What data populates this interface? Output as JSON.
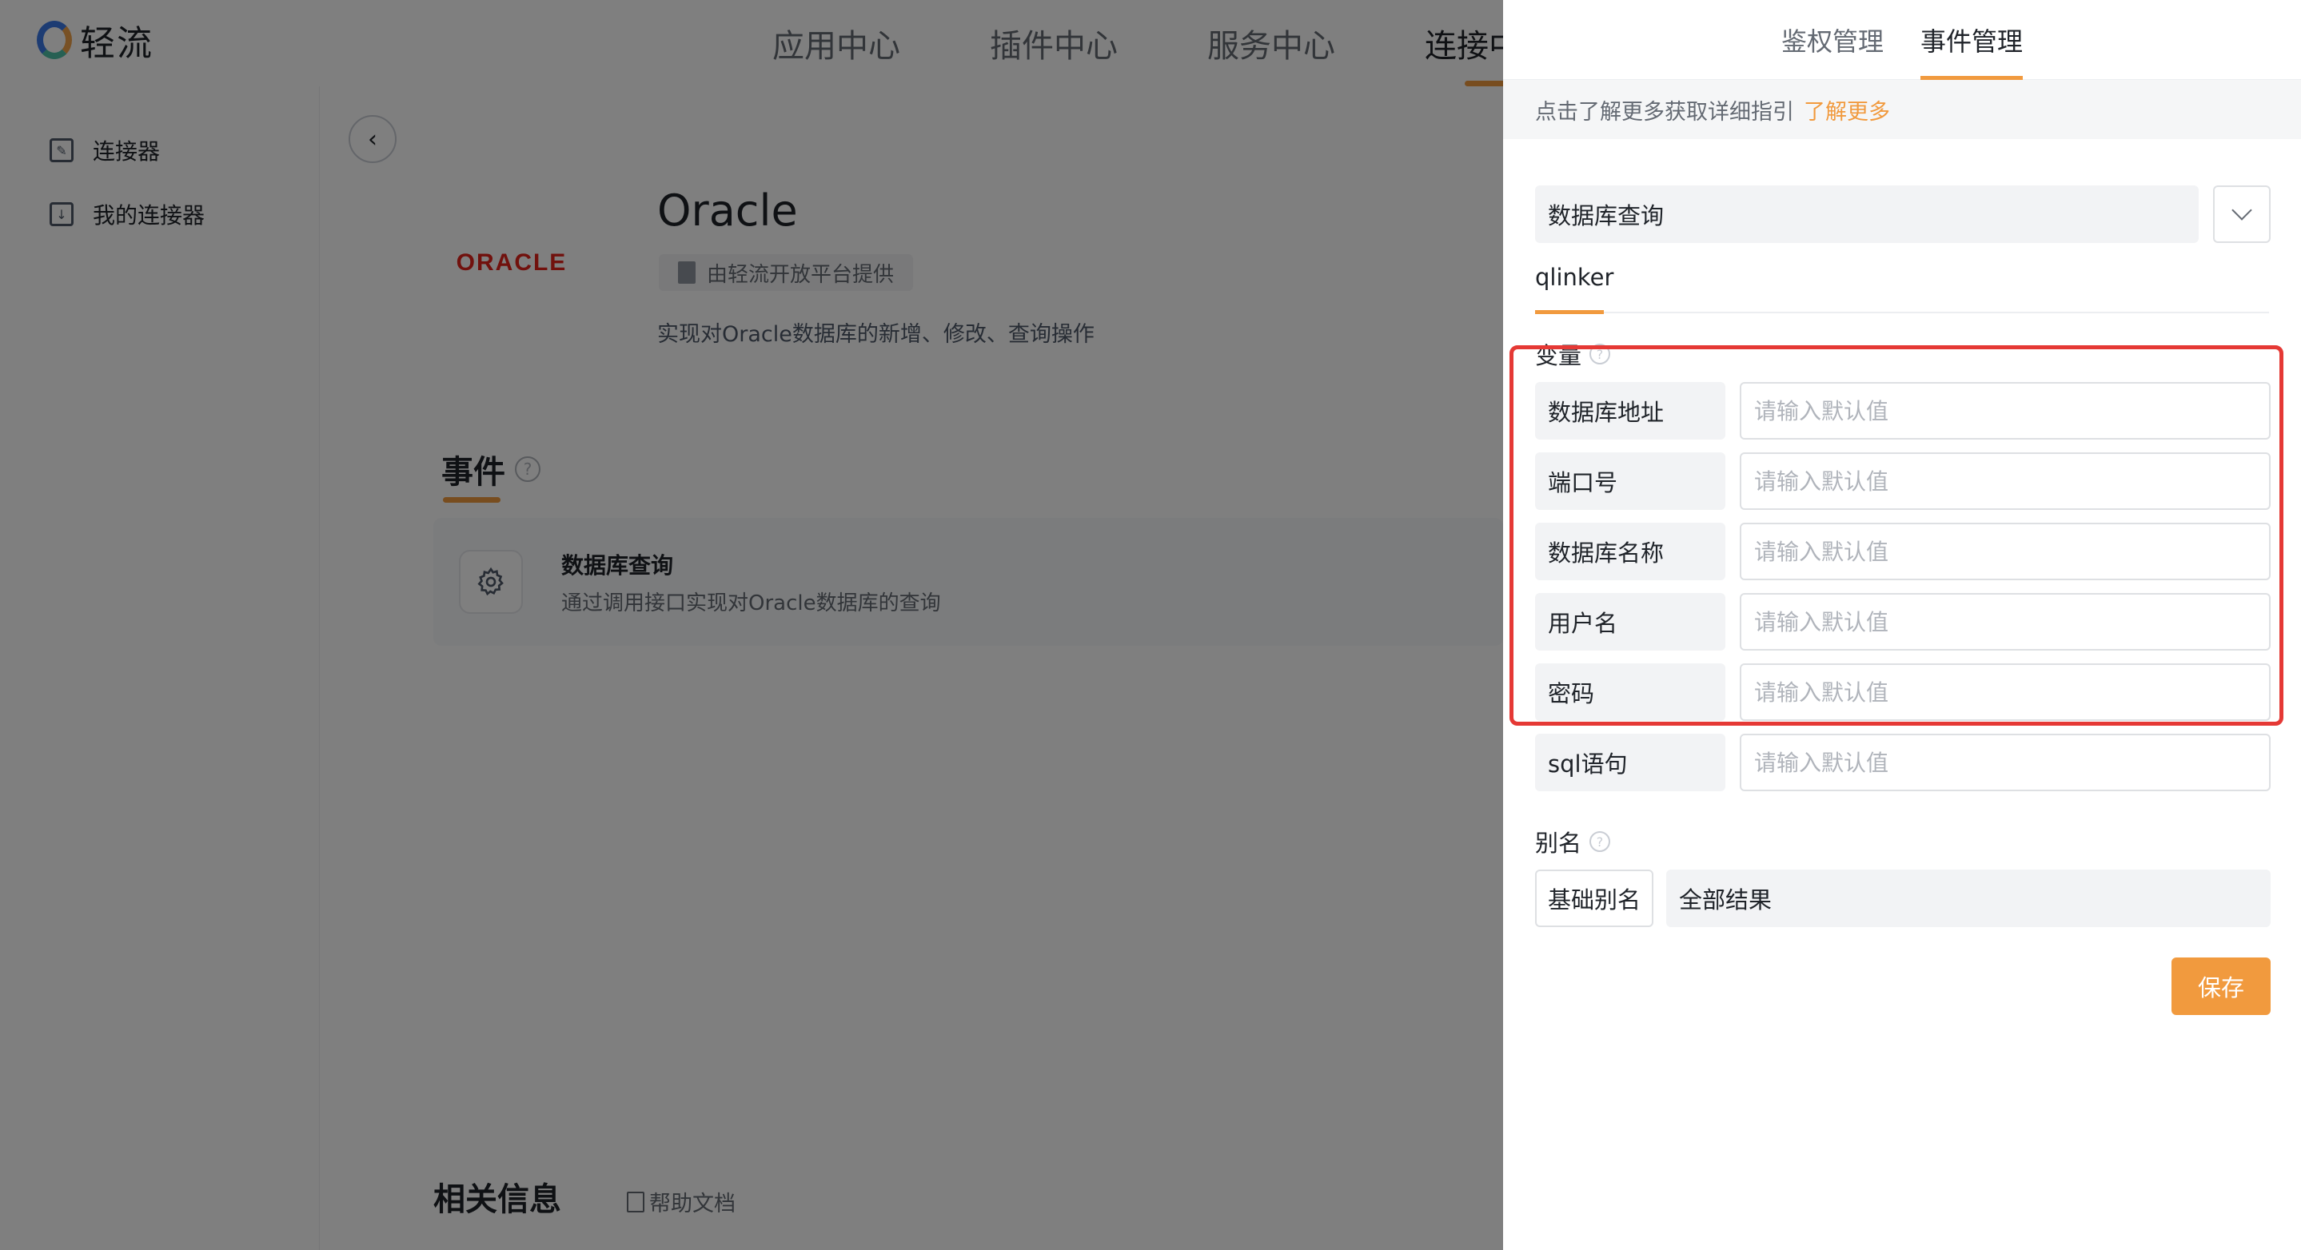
{
  "app": {
    "logo_text": "轻流",
    "nav": [
      "应用中心",
      "插件中心",
      "服务中心",
      "连接中心"
    ]
  },
  "sidebar": {
    "items": [
      {
        "label": "连接器",
        "icon": "connector-icon"
      },
      {
        "label": "我的连接器",
        "icon": "download-icon"
      }
    ]
  },
  "connector": {
    "logo_text": "ORACLE",
    "title": "Oracle",
    "provider": "由轻流开放平台提供",
    "description": "实现对Oracle数据库的新增、修改、查询操作",
    "events_title": "事件",
    "event": {
      "name": "数据库查询",
      "description": "通过调用接口实现对Oracle数据库的查询"
    },
    "related_title": "相关信息",
    "help_doc": "帮助文档"
  },
  "drawer": {
    "tabs": [
      "鉴权管理",
      "事件管理"
    ],
    "active_tab": "事件管理",
    "hint": "点击了解更多获取详细指引",
    "hint_link": "了解更多",
    "event_select": "数据库查询",
    "sub_tab": "qlinker",
    "variables_label": "变量",
    "variables": [
      {
        "label": "数据库地址",
        "placeholder": "请输入默认值"
      },
      {
        "label": "端口号",
        "placeholder": "请输入默认值"
      },
      {
        "label": "数据库名称",
        "placeholder": "请输入默认值"
      },
      {
        "label": "用户名",
        "placeholder": "请输入默认值"
      },
      {
        "label": "密码",
        "placeholder": "请输入默认值"
      },
      {
        "label": "sql语句",
        "placeholder": "请输入默认值"
      }
    ],
    "alias_label": "别名",
    "alias_key": "基础别名",
    "alias_value": "全部结果",
    "save_label": "保存"
  },
  "colors": {
    "accent": "#f19a3e",
    "highlight": "#e53935",
    "oracle_red": "#e2231a"
  }
}
